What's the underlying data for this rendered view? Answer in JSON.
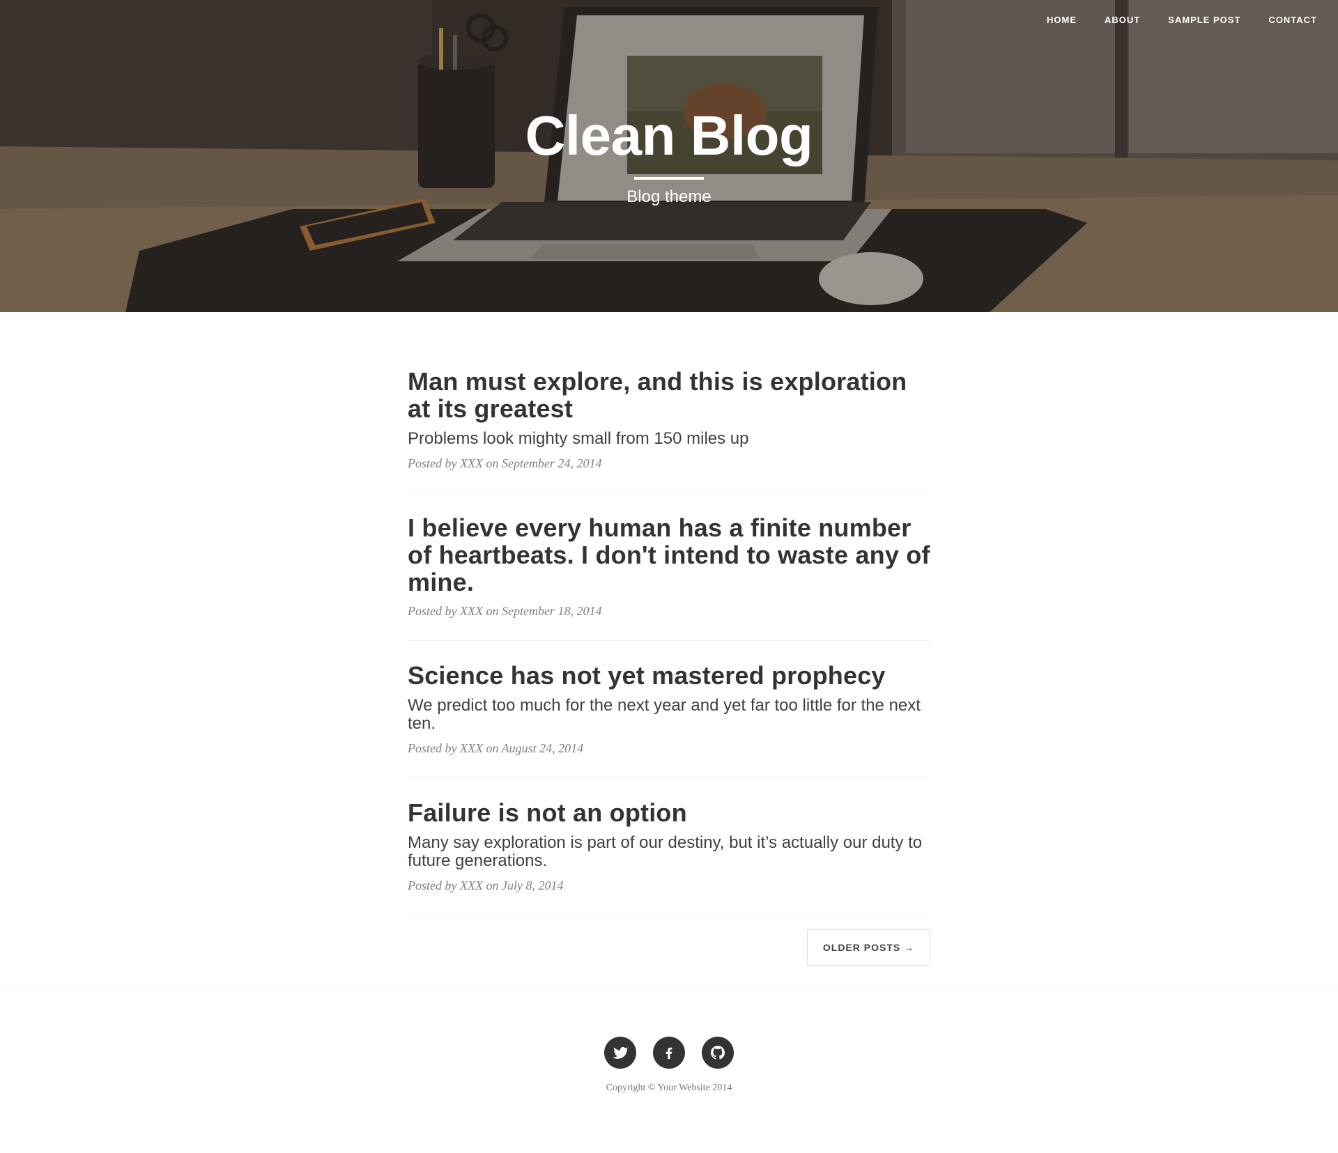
{
  "nav": {
    "items": [
      {
        "label": "HOME"
      },
      {
        "label": "ABOUT"
      },
      {
        "label": "SAMPLE POST"
      },
      {
        "label": "CONTACT"
      }
    ]
  },
  "header": {
    "title": "Clean Blog",
    "subtitle": "Blog theme"
  },
  "posts": [
    {
      "title": "Man must explore, and this is exploration at its greatest",
      "subtitle": "Problems look mighty small from 150 miles up",
      "meta": "Posted by XXX on September 24, 2014"
    },
    {
      "title": "I believe every human has a finite number of heartbeats. I don't intend to waste any of mine.",
      "subtitle": "",
      "meta": "Posted by XXX on September 18, 2014"
    },
    {
      "title": "Science has not yet mastered prophecy",
      "subtitle": "We predict too much for the next year and yet far too little for the next ten.",
      "meta": "Posted by XXX on August 24, 2014"
    },
    {
      "title": "Failure is not an option",
      "subtitle": "Many say exploration is part of our destiny, but it’s actually our duty to future generations.",
      "meta": "Posted by XXX on July 8, 2014"
    }
  ],
  "pager": {
    "older_label": "OLDER POSTS →"
  },
  "footer": {
    "social": [
      {
        "icon": "twitter-icon"
      },
      {
        "icon": "facebook-icon"
      },
      {
        "icon": "github-icon"
      }
    ],
    "copyright": "Copyright © Your Website 2014"
  },
  "colors": {
    "text_dark": "#333333",
    "text_meta": "#808080",
    "social_bg": "#333333",
    "divider": "#eeeeee"
  }
}
